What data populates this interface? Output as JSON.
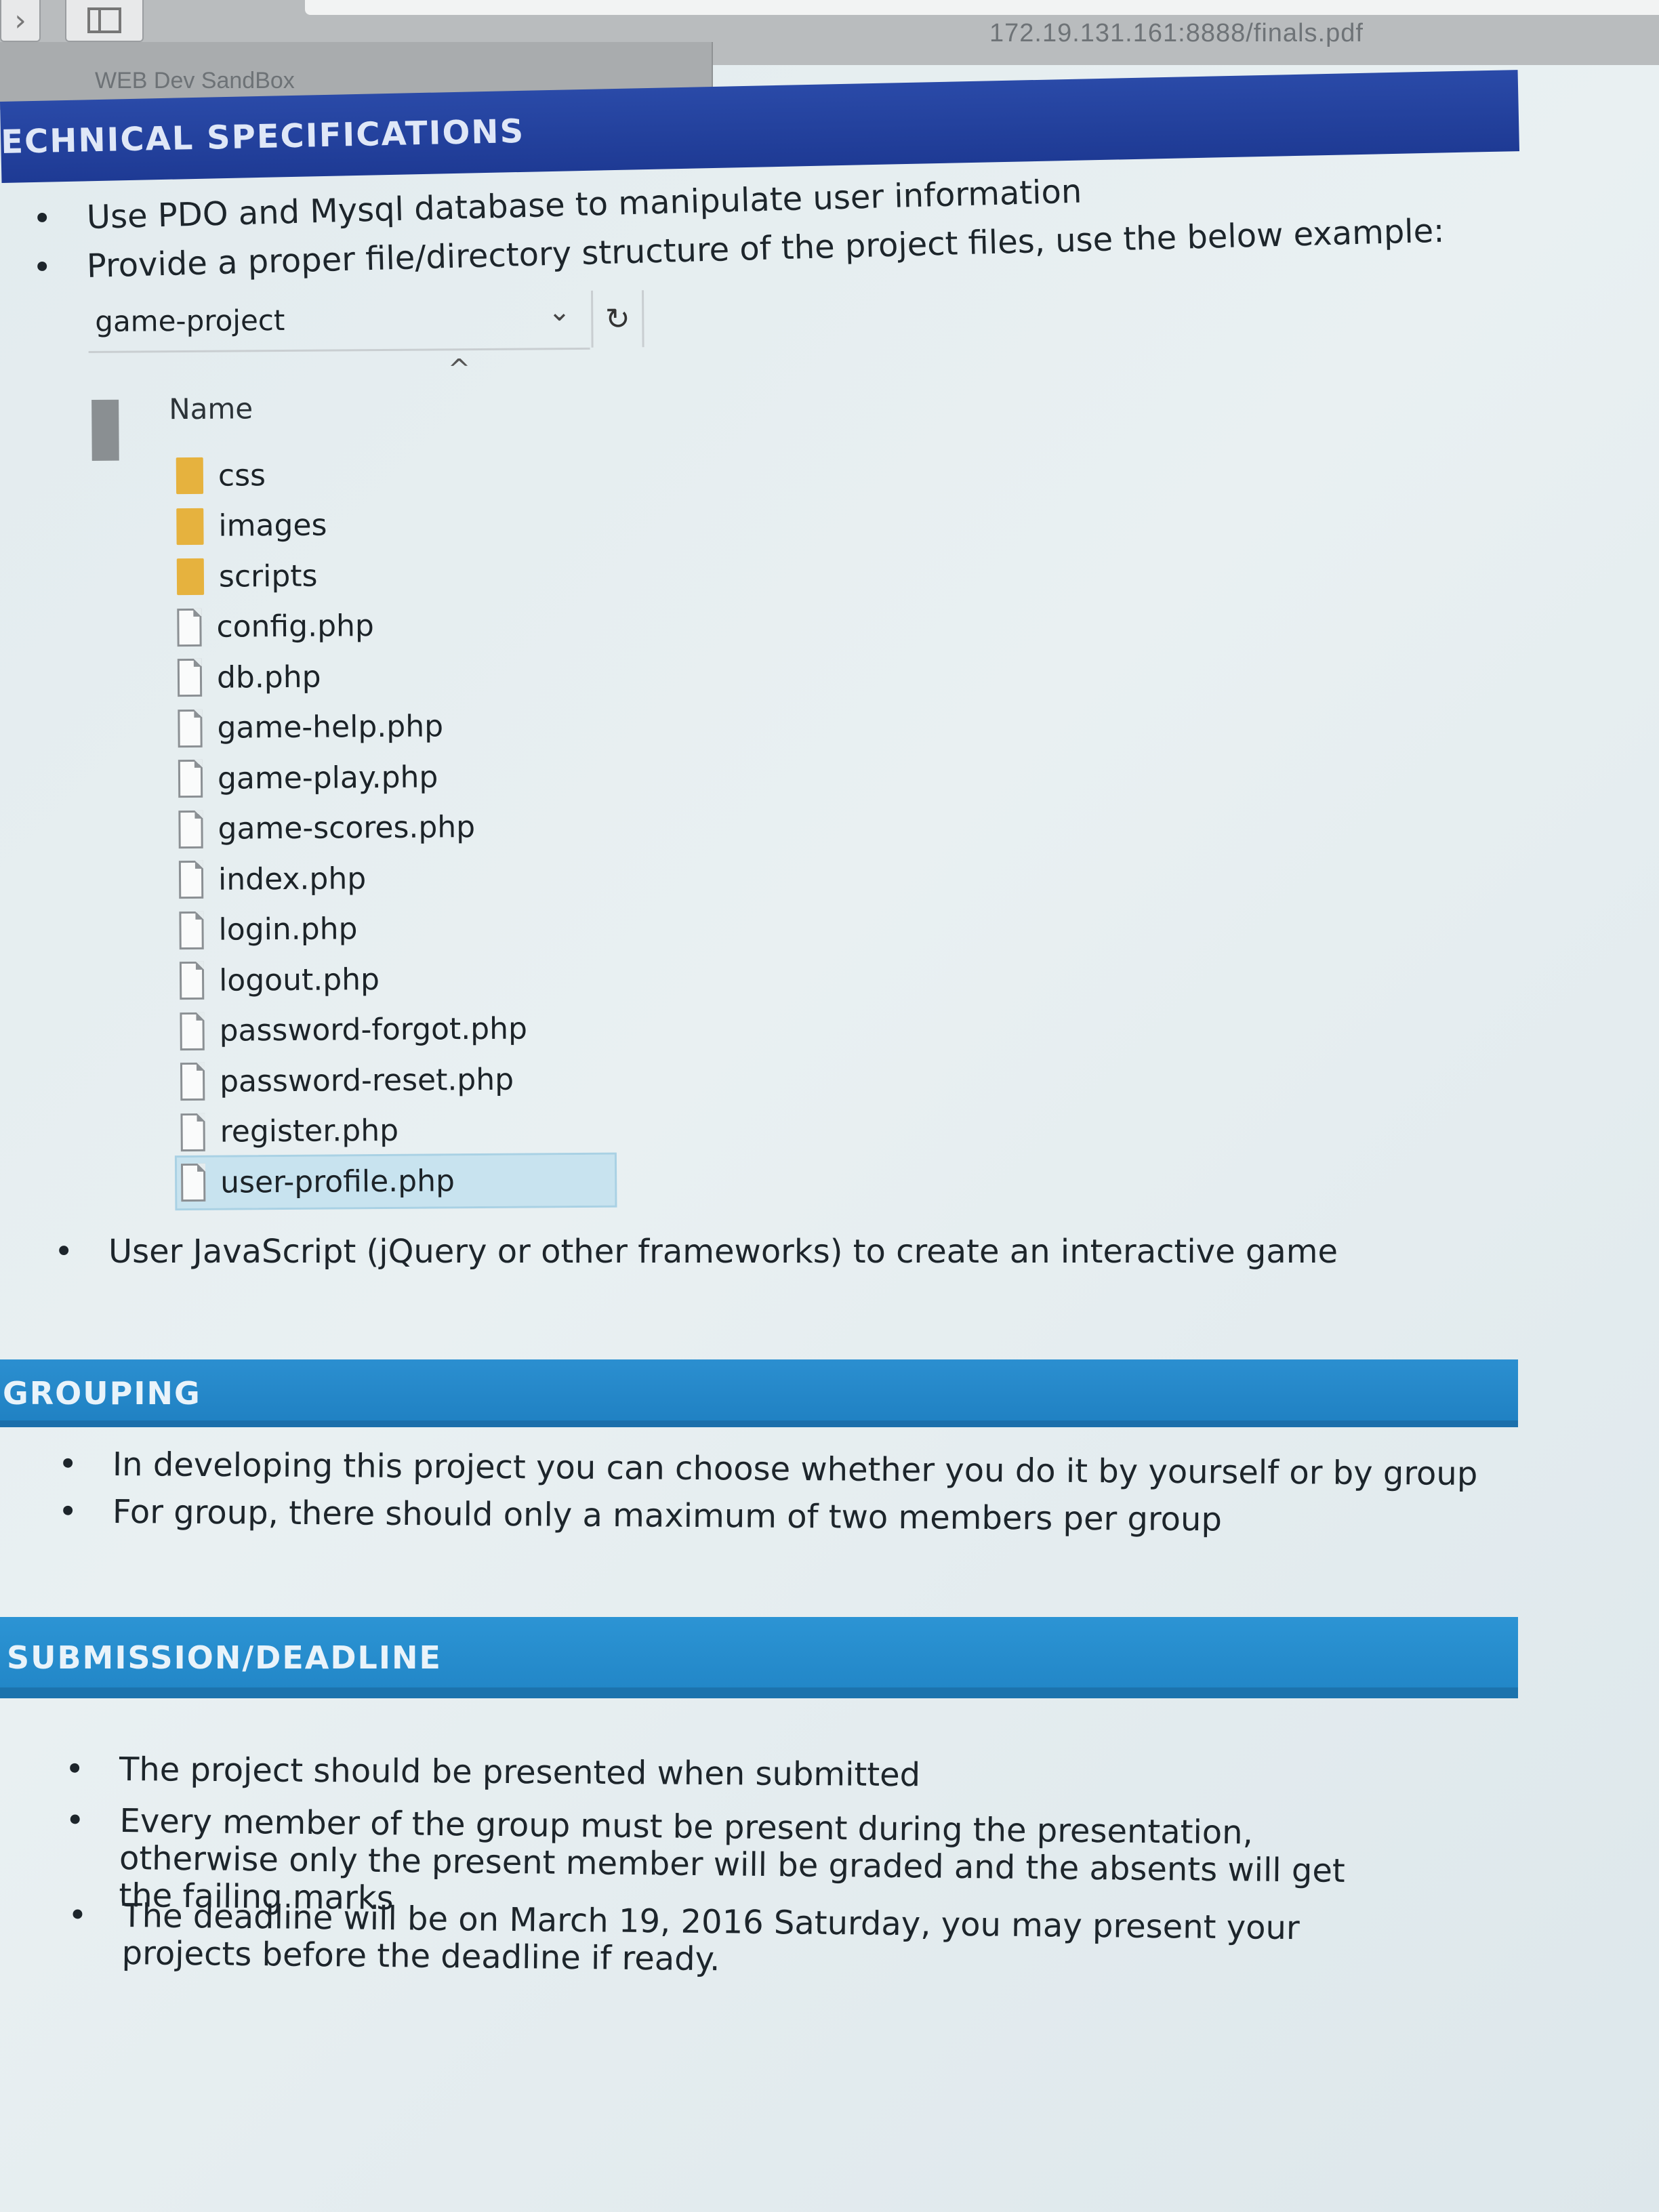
{
  "browser": {
    "tab_title": "WEB Dev SandBox",
    "url": "172.19.131.161:8888/finals.pdf",
    "back_glyph": "›",
    "icons": [
      "back-icon",
      "sidebar-icon"
    ]
  },
  "sections": {
    "technical": {
      "title": "ECHNICAL SPECIFICATIONS",
      "bullets": [
        "Use PDO and Mysql database to manipulate user information",
        "Provide a proper file/directory structure of the project files, use the below example:"
      ],
      "after_bullet": "User JavaScript (jQuery or other frameworks) to create an interactive game"
    },
    "grouping": {
      "title": "GROUPING",
      "bullets": [
        "In developing this project you can choose whether you do it by yourself or by group",
        "For group, there should only a maximum of two members per group"
      ]
    },
    "submission": {
      "title": "SUBMISSION/DEADLINE",
      "bullets": [
        "The project should be presented when submitted",
        "Every member of the group must be present during the presentation, otherwise only the present member will be graded and the absents will get the failing marks",
        "The deadline will be on March 19, 2016 Saturday, you may present your projects before the deadline if ready."
      ]
    }
  },
  "explorer": {
    "path": "game-project",
    "column_header": "Name",
    "chevron_glyph": "⌄",
    "refresh_glyph": "↻",
    "caret_glyph": "^",
    "items": [
      {
        "name": "css",
        "type": "folder"
      },
      {
        "name": "images",
        "type": "folder"
      },
      {
        "name": "scripts",
        "type": "folder"
      },
      {
        "name": "config.php",
        "type": "file"
      },
      {
        "name": "db.php",
        "type": "file"
      },
      {
        "name": "game-help.php",
        "type": "file"
      },
      {
        "name": "game-play.php",
        "type": "file"
      },
      {
        "name": "game-scores.php",
        "type": "file"
      },
      {
        "name": "index.php",
        "type": "file"
      },
      {
        "name": "login.php",
        "type": "file"
      },
      {
        "name": "logout.php",
        "type": "file"
      },
      {
        "name": "password-forgot.php",
        "type": "file"
      },
      {
        "name": "password-reset.php",
        "type": "file"
      },
      {
        "name": "register.php",
        "type": "file"
      },
      {
        "name": "user-profile.php",
        "type": "file",
        "selected": true
      }
    ]
  },
  "colors": {
    "tech_bar": "#2a4aa8",
    "section_bar": "#2b8fd0",
    "folder": "#e6b23e",
    "selection": "#c8e3ef"
  }
}
